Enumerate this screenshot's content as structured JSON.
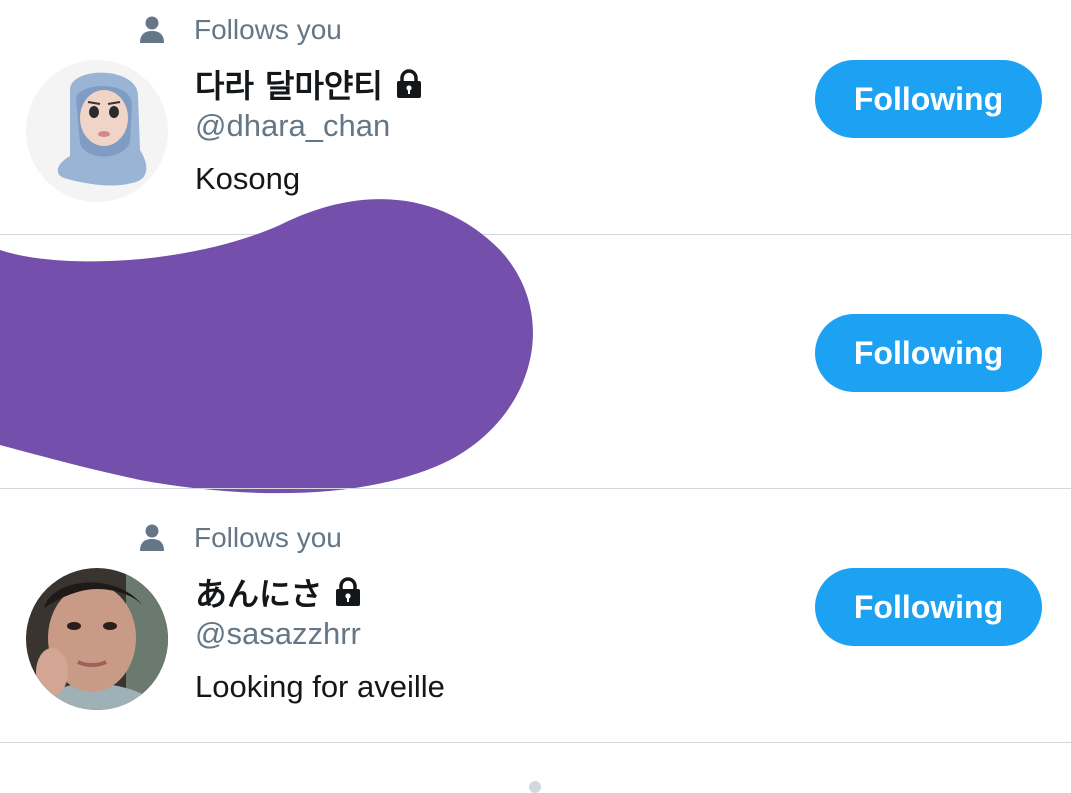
{
  "users": [
    {
      "follows_you": "Follows you",
      "name": "다라 달마얀티",
      "protected": true,
      "handle": "@dhara_chan",
      "bio": "Kosong",
      "button_label": "Following"
    },
    {
      "follows_you": "",
      "name": "",
      "protected": false,
      "handle": "",
      "bio": "",
      "button_label": "Following",
      "redacted": true
    },
    {
      "follows_you": "Follows you",
      "name": "あんにさ",
      "protected": true,
      "handle": "@sasazzhrr",
      "bio": "Looking for aveille",
      "button_label": "Following"
    }
  ],
  "colors": {
    "accent": "#1da1f2",
    "secondary_text": "#657786",
    "primary_text": "#14171a",
    "divider": "#cfd9de",
    "redaction": "#744fab"
  },
  "icons": {
    "follows": "person-icon",
    "protected": "lock-icon"
  }
}
